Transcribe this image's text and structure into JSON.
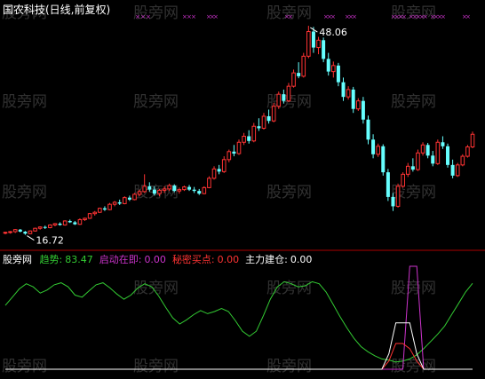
{
  "header": {
    "title": "国农科技(日线,前复权)"
  },
  "watermark": {
    "text": "股旁网",
    "color": "#5a5a5a"
  },
  "price_panel": {
    "high_label": "48.06",
    "low_label": "16.72",
    "marker_color": "#cc33cc",
    "up_color": "#ff3333",
    "down_color": "#66ffff"
  },
  "indicator_panel": {
    "name": "股旁网",
    "items": [
      {
        "label": "趋势:",
        "value": "83.47",
        "color": "#33cc33"
      },
      {
        "label": "启动在即:",
        "value": "0.00",
        "color": "#cc33cc"
      },
      {
        "label": "秘密买点:",
        "value": "0.00",
        "color": "#ff3333"
      },
      {
        "label": "主力建仓:",
        "value": "0.00",
        "color": "#ffffff"
      }
    ]
  },
  "chart_data": [
    {
      "type": "candlestick",
      "title": "国农科技(日线,前复权)",
      "annotations": [
        {
          "text": "48.06",
          "at": "highest high"
        },
        {
          "text": "16.72",
          "at": "lowest low"
        }
      ],
      "ylim": [
        16,
        49
      ],
      "candles": [
        [
          17.0,
          17.2,
          16.8,
          17.1
        ],
        [
          17.1,
          17.3,
          16.9,
          17.2
        ],
        [
          17.2,
          17.6,
          17.0,
          17.5
        ],
        [
          17.5,
          17.6,
          17.1,
          17.2
        ],
        [
          17.2,
          17.3,
          16.72,
          16.9
        ],
        [
          16.9,
          17.4,
          16.8,
          17.3
        ],
        [
          17.3,
          17.8,
          17.2,
          17.7
        ],
        [
          17.7,
          18.0,
          17.5,
          17.9
        ],
        [
          17.9,
          18.1,
          17.6,
          17.8
        ],
        [
          17.8,
          18.3,
          17.7,
          18.2
        ],
        [
          18.2,
          18.5,
          18.0,
          18.4
        ],
        [
          18.4,
          18.6,
          18.1,
          18.2
        ],
        [
          18.2,
          18.9,
          18.1,
          18.8
        ],
        [
          18.8,
          19.0,
          18.5,
          18.6
        ],
        [
          18.6,
          18.8,
          18.2,
          18.3
        ],
        [
          18.3,
          19.2,
          18.2,
          19.0
        ],
        [
          19.0,
          19.3,
          18.8,
          19.2
        ],
        [
          19.2,
          20.0,
          19.1,
          19.9
        ],
        [
          19.9,
          20.3,
          19.6,
          20.1
        ],
        [
          20.1,
          20.8,
          20.0,
          20.7
        ],
        [
          20.7,
          21.0,
          20.3,
          20.5
        ],
        [
          20.5,
          21.5,
          20.4,
          21.3
        ],
        [
          21.3,
          21.8,
          21.0,
          21.6
        ],
        [
          21.6,
          22.0,
          21.2,
          21.4
        ],
        [
          21.4,
          22.5,
          21.3,
          22.3
        ],
        [
          22.3,
          22.6,
          21.8,
          22.0
        ],
        [
          22.0,
          23.0,
          21.9,
          22.8
        ],
        [
          22.8,
          23.5,
          22.5,
          23.2
        ],
        [
          23.2,
          25.8,
          23.0,
          24.0
        ],
        [
          24.0,
          24.6,
          23.2,
          23.5
        ],
        [
          23.5,
          24.0,
          22.6,
          22.9
        ],
        [
          22.9,
          23.6,
          22.5,
          23.4
        ],
        [
          23.4,
          24.0,
          23.0,
          23.6
        ],
        [
          23.6,
          24.4,
          23.3,
          24.1
        ],
        [
          24.1,
          24.3,
          23.1,
          23.3
        ],
        [
          23.3,
          23.8,
          22.9,
          23.5
        ],
        [
          23.5,
          24.1,
          23.3,
          23.9
        ],
        [
          23.9,
          24.2,
          23.3,
          23.5
        ],
        [
          23.5,
          23.9,
          23.0,
          23.3
        ],
        [
          23.3,
          23.6,
          22.7,
          22.9
        ],
        [
          22.9,
          24.0,
          22.8,
          23.8
        ],
        [
          23.8,
          25.5,
          23.7,
          25.2
        ],
        [
          25.2,
          27.0,
          25.0,
          26.6
        ],
        [
          26.6,
          27.2,
          25.8,
          26.2
        ],
        [
          26.2,
          28.5,
          26.0,
          28.0
        ],
        [
          28.0,
          29.5,
          27.6,
          29.2
        ],
        [
          29.2,
          30.2,
          28.5,
          28.9
        ],
        [
          28.9,
          31.0,
          28.7,
          30.6
        ],
        [
          30.6,
          32.0,
          30.2,
          31.5
        ],
        [
          31.5,
          32.4,
          30.4,
          30.8
        ],
        [
          30.8,
          33.5,
          30.6,
          33.0
        ],
        [
          33.0,
          34.2,
          32.3,
          32.7
        ],
        [
          32.7,
          35.0,
          32.5,
          34.5
        ],
        [
          34.5,
          35.5,
          33.4,
          33.8
        ],
        [
          33.8,
          36.5,
          33.6,
          36.0
        ],
        [
          36.0,
          38.2,
          35.6,
          37.8
        ],
        [
          37.8,
          38.5,
          36.4,
          36.8
        ],
        [
          36.8,
          39.5,
          36.6,
          39.0
        ],
        [
          39.0,
          41.5,
          38.8,
          41.0
        ],
        [
          41.0,
          42.6,
          40.2,
          40.5
        ],
        [
          40.5,
          44.0,
          40.3,
          43.5
        ],
        [
          43.5,
          48.06,
          43.2,
          47.2
        ],
        [
          47.2,
          47.9,
          44.0,
          44.8
        ],
        [
          44.8,
          46.4,
          43.8,
          45.9
        ],
        [
          45.9,
          46.3,
          42.6,
          43.1
        ],
        [
          43.1,
          44.0,
          40.6,
          41.2
        ],
        [
          41.2,
          42.7,
          40.3,
          42.1
        ],
        [
          42.1,
          42.5,
          39.0,
          39.6
        ],
        [
          39.6,
          40.3,
          36.8,
          37.4
        ],
        [
          37.4,
          39.0,
          37.0,
          38.5
        ],
        [
          38.5,
          38.9,
          35.0,
          35.6
        ],
        [
          35.6,
          37.2,
          35.3,
          36.8
        ],
        [
          36.8,
          37.4,
          33.4,
          34.0
        ],
        [
          34.0,
          34.6,
          30.3,
          31.0
        ],
        [
          31.0,
          31.8,
          28.2,
          28.8
        ],
        [
          28.8,
          30.4,
          28.4,
          30.0
        ],
        [
          30.0,
          30.3,
          25.6,
          26.1
        ],
        [
          26.1,
          26.6,
          21.8,
          22.4
        ],
        [
          22.4,
          23.0,
          20.3,
          21.0
        ],
        [
          21.0,
          24.4,
          20.8,
          24.0
        ],
        [
          24.0,
          26.1,
          23.8,
          25.8
        ],
        [
          25.8,
          27.5,
          25.4,
          27.0
        ],
        [
          27.0,
          28.2,
          26.2,
          26.5
        ],
        [
          26.5,
          29.5,
          26.3,
          29.0
        ],
        [
          29.0,
          30.6,
          28.6,
          30.2
        ],
        [
          30.2,
          30.5,
          28.2,
          28.6
        ],
        [
          28.6,
          29.3,
          27.0,
          27.4
        ],
        [
          27.4,
          31.0,
          27.2,
          30.6
        ],
        [
          30.6,
          31.5,
          29.6,
          30.0
        ],
        [
          30.0,
          30.4,
          26.8,
          27.2
        ],
        [
          27.2,
          28.0,
          25.2,
          25.6
        ],
        [
          25.6,
          27.5,
          25.4,
          27.2
        ],
        [
          27.2,
          28.8,
          27.0,
          28.5
        ],
        [
          28.5,
          30.2,
          28.3,
          29.9
        ],
        [
          29.9,
          32.2,
          29.7,
          31.8
        ]
      ]
    },
    {
      "type": "line",
      "series": [
        {
          "name": "趋势",
          "color": "#33cc33",
          "values": [
            62,
            70,
            78,
            83,
            80,
            74,
            77,
            82,
            84,
            80,
            72,
            70,
            76,
            82,
            84,
            79,
            73,
            68,
            72,
            79,
            83,
            80,
            71,
            60,
            50,
            44,
            48,
            53,
            57,
            54,
            56,
            59,
            56,
            47,
            37,
            32,
            37,
            52,
            68,
            80,
            85,
            83,
            80,
            81,
            85,
            83,
            75,
            63,
            51,
            40,
            30,
            22,
            17,
            13,
            10,
            9,
            7,
            8,
            10,
            14,
            20,
            27,
            34,
            42,
            53,
            64,
            75,
            83.47
          ]
        },
        {
          "name": "启动在即",
          "color": "#cc33cc",
          "values": [
            0,
            0,
            0,
            0,
            0,
            0,
            0,
            0,
            0,
            0,
            0,
            0,
            0,
            0,
            0,
            0,
            0,
            0,
            0,
            0,
            0,
            0,
            0,
            0,
            0,
            0,
            0,
            0,
            0,
            0,
            0,
            0,
            0,
            0,
            0,
            0,
            0,
            0,
            0,
            0,
            0,
            0,
            0,
            0,
            0,
            0,
            0,
            0,
            0,
            0,
            0,
            0,
            0,
            0,
            0,
            0,
            0,
            0,
            100,
            100,
            0,
            0,
            0,
            0,
            0,
            0,
            0,
            0
          ]
        },
        {
          "name": "秘密买点",
          "color": "#ff3333",
          "values": [
            0,
            0,
            0,
            0,
            0,
            0,
            0,
            0,
            0,
            0,
            0,
            0,
            0,
            0,
            0,
            0,
            0,
            0,
            0,
            0,
            0,
            0,
            0,
            0,
            0,
            0,
            0,
            0,
            0,
            0,
            0,
            0,
            0,
            0,
            0,
            0,
            0,
            0,
            0,
            0,
            0,
            0,
            0,
            0,
            0,
            0,
            0,
            0,
            0,
            0,
            0,
            0,
            0,
            0,
            0,
            8,
            25,
            25,
            20,
            8,
            0,
            0,
            0,
            0,
            0,
            0,
            0,
            0
          ]
        },
        {
          "name": "主力建仓",
          "color": "#ffffff",
          "values": [
            0,
            0,
            0,
            0,
            0,
            0,
            0,
            0,
            0,
            0,
            0,
            0,
            0,
            0,
            0,
            0,
            0,
            0,
            0,
            0,
            0,
            0,
            0,
            0,
            0,
            0,
            0,
            0,
            0,
            0,
            0,
            0,
            0,
            0,
            0,
            0,
            0,
            0,
            0,
            0,
            0,
            0,
            0,
            0,
            0,
            0,
            0,
            0,
            0,
            0,
            0,
            0,
            0,
            0,
            0,
            15,
            45,
            45,
            45,
            15,
            0,
            0,
            0,
            0,
            0,
            0,
            0,
            0
          ]
        }
      ],
      "ylim": [
        0,
        100
      ]
    }
  ]
}
